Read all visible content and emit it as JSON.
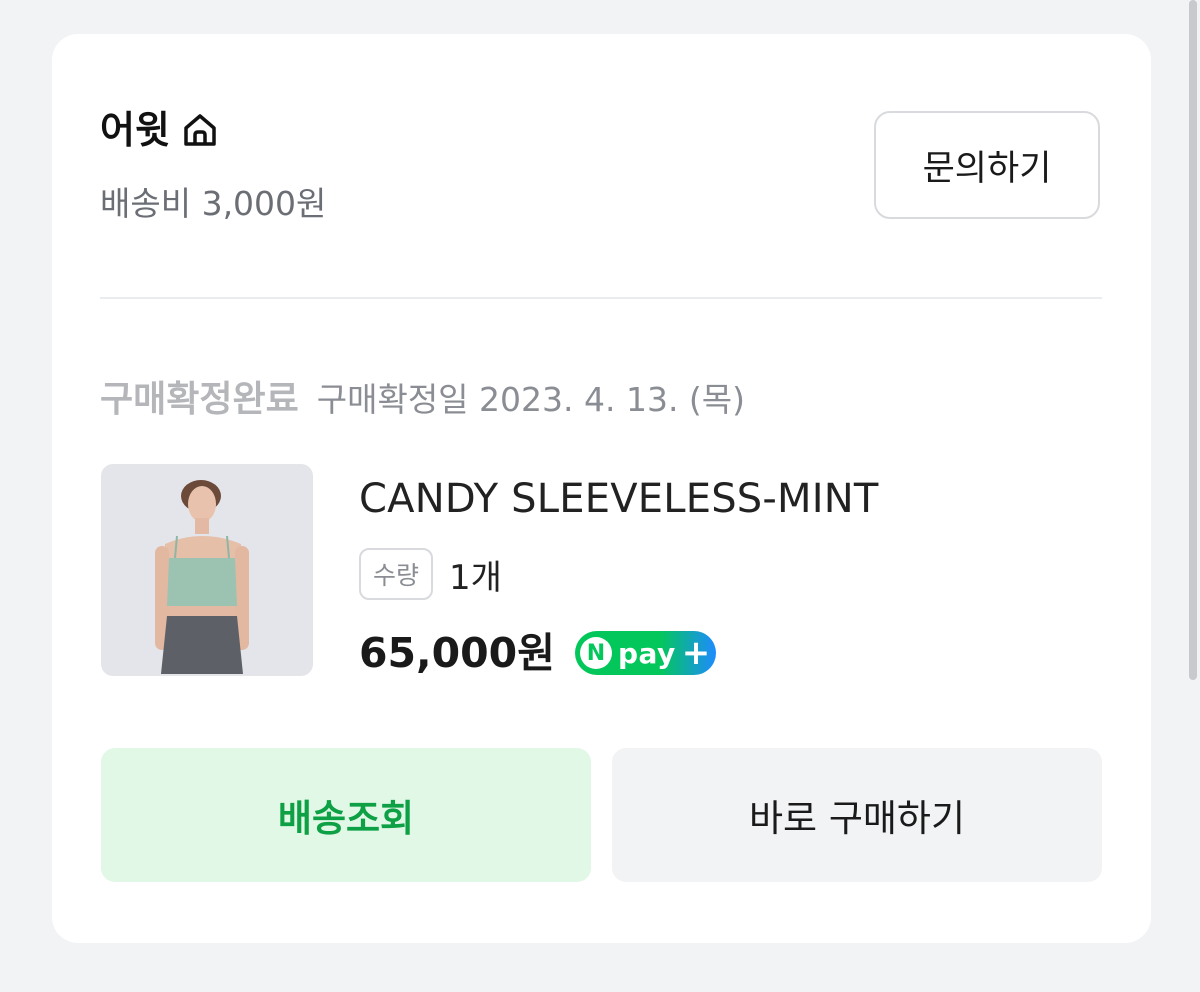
{
  "seller": {
    "name": "어윗",
    "shipping_fee": "배송비 3,000원",
    "inquiry_label": "문의하기"
  },
  "order": {
    "status": "구매확정완료",
    "confirm_date": "구매확정일 2023. 4. 13. (목)"
  },
  "product": {
    "name": "CANDY SLEEVELESS-MINT",
    "qty_label": "수량",
    "qty_value": "1개",
    "price": "65,000원",
    "payment_badge": {
      "n": "N",
      "text": "pay",
      "plus": "+"
    }
  },
  "actions": {
    "track_label": "배송조회",
    "buy_label": "바로 구매하기"
  },
  "colors": {
    "track_text": "#0ea044",
    "track_bg": "#e1f8e7",
    "npay_green": "#03c75a",
    "npay_blue": "#1e8bff"
  }
}
